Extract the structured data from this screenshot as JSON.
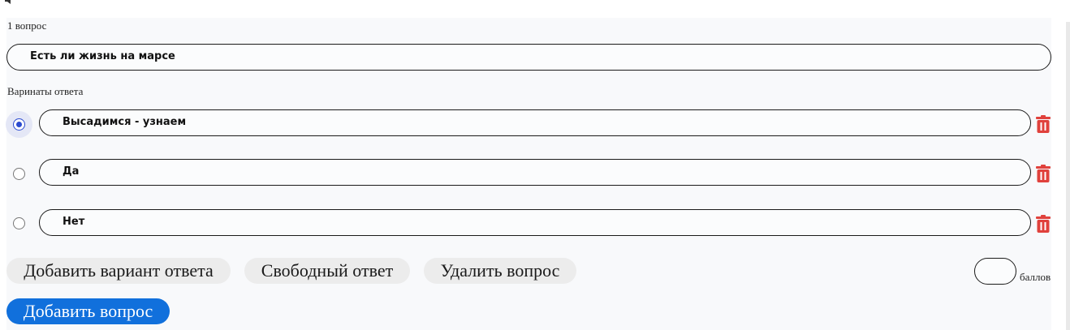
{
  "question": {
    "number_label": "1 вопрос",
    "text": "Есть ли жизнь на марсе"
  },
  "answers": {
    "label": "Варинаты ответа",
    "items": [
      {
        "text": "Высадимся - узнаем",
        "selected": true
      },
      {
        "text": "Да",
        "selected": false
      },
      {
        "text": "Нет",
        "selected": false
      }
    ]
  },
  "actions": {
    "add_answer": "Добавить вариант ответа",
    "free_answer": "Свободный ответ",
    "delete_question": "Удалить вопрос",
    "add_question": "Добавить вопрос"
  },
  "points": {
    "value": "",
    "label": "баллов"
  },
  "icons": {
    "delete_answer": "trash-icon",
    "selected_radio": "radio-checked-icon",
    "corner": "speaker-icon"
  },
  "colors": {
    "primary": "#1170dc",
    "danger": "#e0413c",
    "radio_accent": "#2c4bcf",
    "button_bg": "#ececec",
    "panel_bg": "#f8f9fb"
  }
}
